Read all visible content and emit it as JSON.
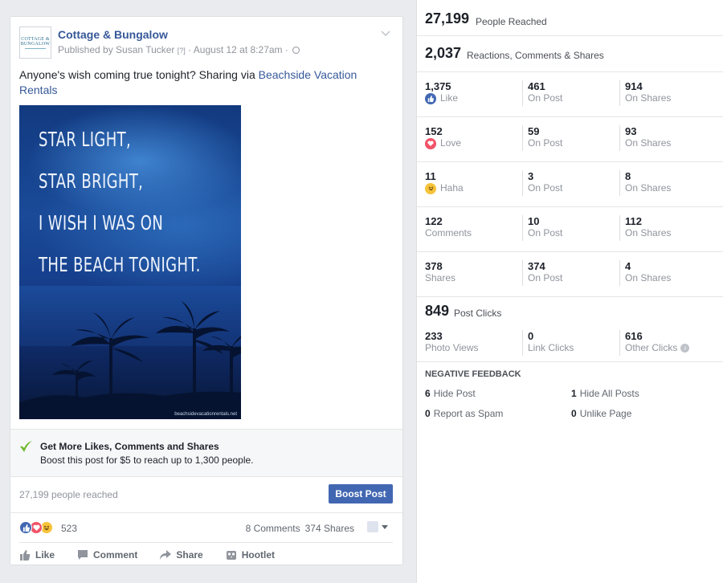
{
  "post": {
    "page_name": "Cottage & Bungalow",
    "logo_text_1": "COTTAGE &",
    "logo_text_2": "BUNGALOW",
    "published_by": "Published by Susan Tucker",
    "help_marker": "[?]",
    "date": "· August 12 at 8:27am ·",
    "text": "Anyone's wish coming true tonight? Sharing via ",
    "link_text": "Beachside Vacation Rentals",
    "image": {
      "lines": [
        "STAR LIGHT,",
        "STAR BRIGHT,",
        "I WISH I WAS ON",
        "THE BEACH TONIGHT."
      ],
      "watermark": "beachsidevacationrentals.net"
    },
    "promo": {
      "title": "Get More Likes, Comments and Shares",
      "subtitle": "Boost this post for $5 to reach up to 1,300 people."
    },
    "reach_text": "27,199 people reached",
    "boost_button": "Boost Post",
    "reaction_count": "523",
    "comments": "8 Comments",
    "shares": "374 Shares",
    "actions": {
      "like": "Like",
      "comment": "Comment",
      "share": "Share",
      "hootlet": "Hootlet"
    }
  },
  "insights": {
    "people_reached": {
      "value": "27,199",
      "label": "People Reached"
    },
    "engagement": {
      "value": "2,037",
      "label": "Reactions, Comments & Shares"
    },
    "rows": [
      {
        "total": "1,375",
        "label": "Like",
        "icon": "like",
        "on_post": "461",
        "on_shares": "914"
      },
      {
        "total": "152",
        "label": "Love",
        "icon": "love",
        "on_post": "59",
        "on_shares": "93"
      },
      {
        "total": "11",
        "label": "Haha",
        "icon": "haha",
        "on_post": "3",
        "on_shares": "8"
      },
      {
        "total": "122",
        "label": "Comments",
        "icon": "",
        "on_post": "10",
        "on_shares": "112"
      },
      {
        "total": "378",
        "label": "Shares",
        "icon": "",
        "on_post": "374",
        "on_shares": "4"
      }
    ],
    "on_post_label": "On Post",
    "on_shares_label": "On Shares",
    "post_clicks": {
      "value": "849",
      "label": "Post Clicks"
    },
    "clicks": [
      {
        "value": "233",
        "label": "Photo Views"
      },
      {
        "value": "0",
        "label": "Link Clicks"
      },
      {
        "value": "616",
        "label": "Other Clicks"
      }
    ],
    "negative": {
      "title": "NEGATIVE FEEDBACK",
      "hide_post": {
        "value": "6",
        "label": "Hide Post"
      },
      "hide_all": {
        "value": "1",
        "label": "Hide All Posts"
      },
      "spam": {
        "value": "0",
        "label": "Report as Spam"
      },
      "unlike": {
        "value": "0",
        "label": "Unlike Page"
      }
    }
  },
  "colors": {
    "link": "#365899",
    "button": "#4267b2",
    "like": "#4267b2",
    "love": "#f25268",
    "haha": "#f7c33b",
    "check": "#6fb92c"
  }
}
